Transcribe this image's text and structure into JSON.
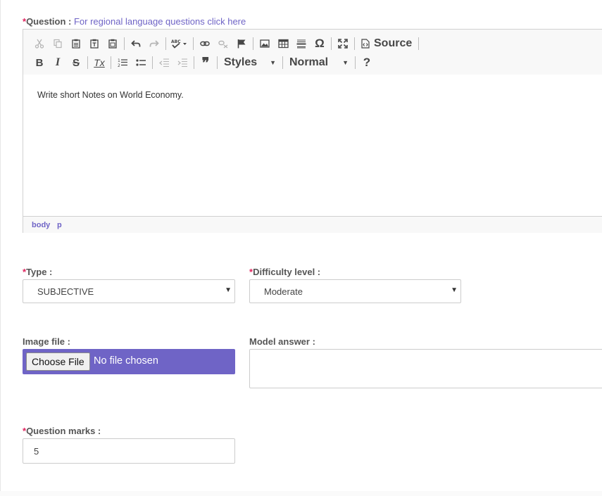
{
  "question": {
    "required_mark": "*",
    "label": "Question :",
    "link_text": "For regional language questions click here"
  },
  "editor": {
    "toolbar_row1": [
      {
        "icon": "cut-icon",
        "disabled": true
      },
      {
        "icon": "copy-icon",
        "disabled": true
      },
      {
        "icon": "paste-icon",
        "disabled": false
      },
      {
        "icon": "paste-text-icon",
        "disabled": false
      },
      {
        "icon": "paste-word-icon",
        "disabled": false
      },
      {
        "icon": "undo-icon",
        "disabled": false
      },
      {
        "icon": "redo-icon",
        "disabled": true
      },
      {
        "icon": "spellcheck-icon",
        "disabled": false
      },
      {
        "icon": "link-icon",
        "disabled": false
      },
      {
        "icon": "unlink-icon",
        "disabled": true
      },
      {
        "icon": "anchor-flag-icon",
        "disabled": false
      },
      {
        "icon": "image-icon",
        "disabled": false
      },
      {
        "icon": "table-icon",
        "disabled": false
      },
      {
        "icon": "horizontal-line-icon",
        "disabled": false
      },
      {
        "icon": "special-char-icon",
        "disabled": false
      },
      {
        "icon": "maximize-icon",
        "disabled": false
      },
      {
        "icon": "source-icon",
        "disabled": false
      }
    ],
    "special_char_glyph": "Ω",
    "source_label": "Source",
    "styles_label": "Styles",
    "format_label": "Normal",
    "help_glyph": "?",
    "bold_glyph": "B",
    "italic_glyph": "I",
    "strike_glyph": "S",
    "clear_format_glyph": "Tx",
    "blockquote_glyph": "❞",
    "content_text": "Write short Notes on World Economy.",
    "path": [
      "body",
      "p"
    ]
  },
  "type_field": {
    "required_mark": "*",
    "label": "Type :",
    "value": "SUBJECTIVE"
  },
  "difficulty_field": {
    "required_mark": "*",
    "label": "Difficulty level :",
    "value": "Moderate"
  },
  "image_file": {
    "label": "Image file :",
    "button_label": "Choose File",
    "status_text": "No file chosen"
  },
  "model_answer": {
    "label": "Model answer :",
    "value": ""
  },
  "question_marks": {
    "required_mark": "*",
    "label": "Question marks :",
    "value": "5"
  },
  "colors": {
    "accent": "#6f64c6",
    "required": "#e0245e",
    "border": "#cccccc"
  }
}
